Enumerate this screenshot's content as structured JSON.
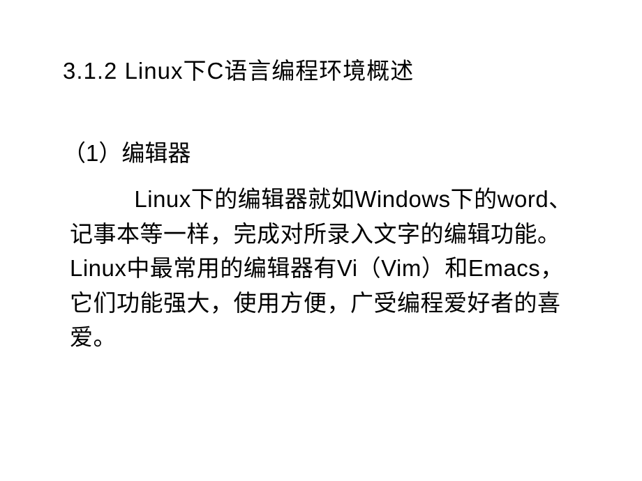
{
  "slide": {
    "heading": "3.1.2 Linux下C语言编程环境概述",
    "subheading": "（1）编辑器",
    "body": "Linux下的编辑器就如Windows下的word、记事本等一样，完成对所录入文字的编辑功能。Linux中最常用的编辑器有Vi（Vim）和Emacs，它们功能强大，使用方便，广受编程爱好者的喜爱。"
  }
}
